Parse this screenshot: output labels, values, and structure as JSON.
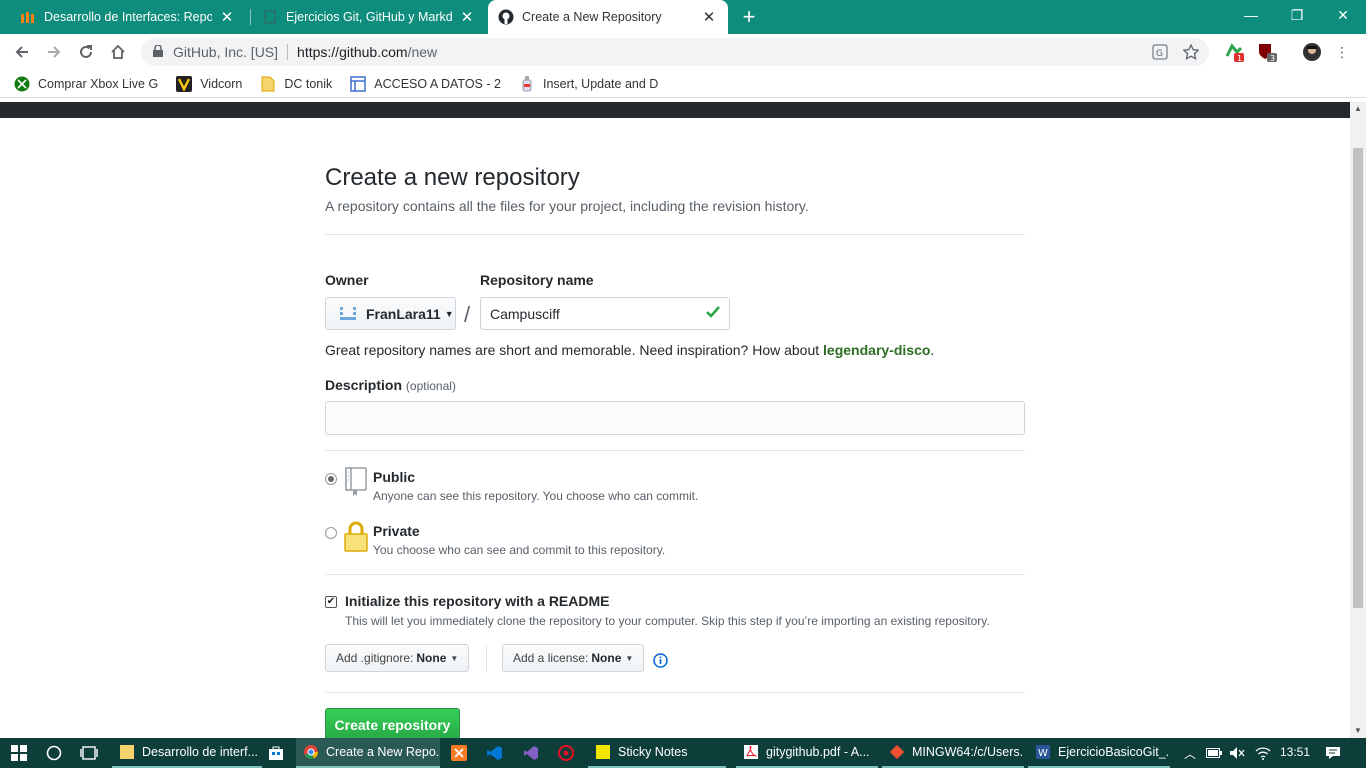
{
  "browser": {
    "tabs": [
      {
        "title": "Desarrollo de Interfaces: Reposito",
        "active": false
      },
      {
        "title": "Ejercicios Git, GitHub y Markdown",
        "active": false
      },
      {
        "title": "Create a New Repository",
        "active": true
      }
    ],
    "new_tab_label": "+",
    "site_identity": "GitHub, Inc. [US]",
    "url_host": "https://github.com",
    "url_path": "/new",
    "ext_badges": [
      "1",
      "3"
    ],
    "bookmarks": [
      {
        "label": "Comprar Xbox Live G"
      },
      {
        "label": "Vidcorn"
      },
      {
        "label": "DC tonik"
      },
      {
        "label": "ACCESO A DATOS - 2"
      },
      {
        "label": "Insert, Update and D"
      }
    ]
  },
  "page": {
    "title": "Create a new repository",
    "subtitle": "A repository contains all the files for your project, including the revision history.",
    "owner_label": "Owner",
    "owner_value": "FranLara11",
    "repo_name_label": "Repository name",
    "repo_name_value": "Campusciff",
    "slash": "/",
    "name_hint": "Great repository names are short and memorable. Need inspiration? How about ",
    "name_suggestion": "legendary-disco",
    "name_hint_end": ".",
    "description_label": "Description",
    "description_optional": "(optional)",
    "description_value": "",
    "visibility": [
      {
        "title": "Public",
        "desc": "Anyone can see this repository. You choose who can commit.",
        "checked": true
      },
      {
        "title": "Private",
        "desc": "You choose who can see and commit to this repository.",
        "checked": false
      }
    ],
    "readme_label": "Initialize this repository with a README",
    "readme_desc": "This will let you immediately clone the repository to your computer. Skip this step if you’re importing an existing repository.",
    "readme_checked": true,
    "gitignore_label": "Add .gitignore:",
    "gitignore_value": "None",
    "license_label": "Add a license:",
    "license_value": "None",
    "create_button": "Create repository"
  },
  "taskbar": {
    "apps": [
      {
        "label": "Desarrollo de interf..."
      },
      {
        "label": "Create a New Repo..."
      },
      {
        "label": "Sticky Notes"
      },
      {
        "label": "gitygithub.pdf - A..."
      },
      {
        "label": "MINGW64:/c/Users..."
      },
      {
        "label": "EjercicioBasicoGit_..."
      }
    ],
    "time": "13:51"
  },
  "colors": {
    "tab_bar": "#0e8c7c",
    "create_button": "#28a745",
    "suggestion": "#2c6e22",
    "taskbar": "#0e3e3a"
  }
}
